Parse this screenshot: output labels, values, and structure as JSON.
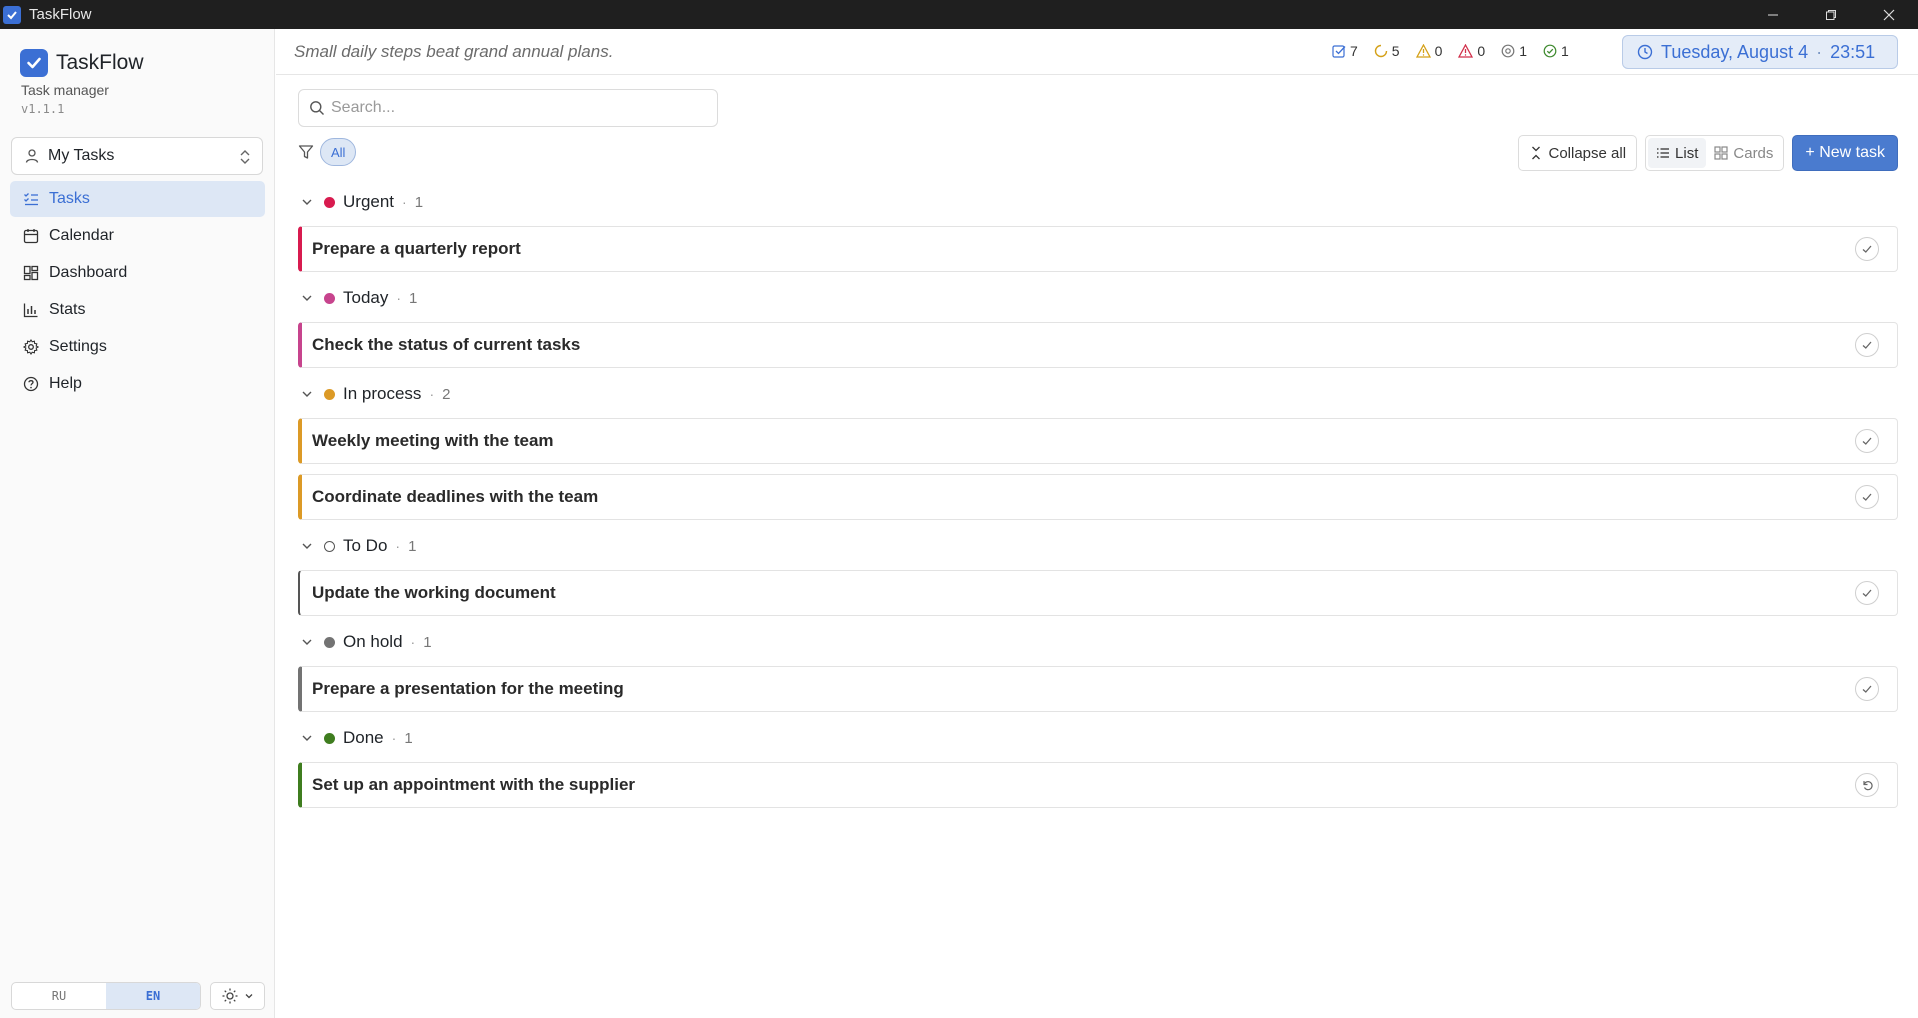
{
  "window": {
    "title": "TaskFlow"
  },
  "sidebar": {
    "brand": "TaskFlow",
    "subtitle": "Task manager",
    "version": "v1.1.1",
    "project": "My Tasks",
    "nav": [
      {
        "label": "Tasks",
        "icon": "list-checks-icon",
        "active": true
      },
      {
        "label": "Calendar",
        "icon": "calendar-icon",
        "active": false
      },
      {
        "label": "Dashboard",
        "icon": "dashboard-grid-icon",
        "active": false
      },
      {
        "label": "Stats",
        "icon": "bar-chart-icon",
        "active": false
      },
      {
        "label": "Settings",
        "icon": "gear-icon",
        "active": false
      },
      {
        "label": "Help",
        "icon": "help-circle-icon",
        "active": false
      }
    ],
    "lang_options": [
      "RU",
      "EN"
    ],
    "lang_active": "EN"
  },
  "header": {
    "quote": "Small daily steps beat grand annual plans.",
    "counters": [
      {
        "name": "total",
        "icon": "checkbox-icon",
        "value": "7",
        "color": "#3b6fd4"
      },
      {
        "name": "in-progress",
        "icon": "progress-circle-icon",
        "value": "5",
        "color": "#d4a017"
      },
      {
        "name": "warning",
        "icon": "warning-triangle-icon",
        "value": "0",
        "color": "#d4a017"
      },
      {
        "name": "overdue",
        "icon": "alert-triangle-icon",
        "value": "0",
        "color": "#d12f4a"
      },
      {
        "name": "paused",
        "icon": "pause-circle-icon",
        "value": "1",
        "color": "#777777"
      },
      {
        "name": "done",
        "icon": "check-circle-icon",
        "value": "1",
        "color": "#3f8a2f"
      }
    ],
    "date": "Tuesday, August 4",
    "time": "23:51"
  },
  "main": {
    "search_placeholder": "Search...",
    "filter_all": "All",
    "collapse_all": "Collapse all",
    "view_list": "List",
    "view_cards": "Cards",
    "new_task": "+ New task",
    "groups": [
      {
        "name": "Urgent",
        "count": "1",
        "color": "#d81b4f",
        "tasks": [
          "Prepare a quarterly report"
        ]
      },
      {
        "name": "Today",
        "count": "1",
        "color": "#c7448d",
        "tasks": [
          "Check the status of current tasks"
        ]
      },
      {
        "name": "In process",
        "count": "2",
        "color": "#dc9a26",
        "tasks": [
          "Weekly meeting with the team",
          "Coordinate deadlines with the team"
        ]
      },
      {
        "name": "To Do",
        "count": "1",
        "color": "#555555",
        "outline": true,
        "tasks": [
          "Update the working document"
        ]
      },
      {
        "name": "On hold",
        "count": "1",
        "color": "#737373",
        "tasks": [
          "Prepare a presentation for the meeting"
        ]
      },
      {
        "name": "Done",
        "count": "1",
        "color": "#3f7d1f",
        "done": true,
        "tasks": [
          "Set up an appointment with the supplier"
        ]
      }
    ]
  }
}
